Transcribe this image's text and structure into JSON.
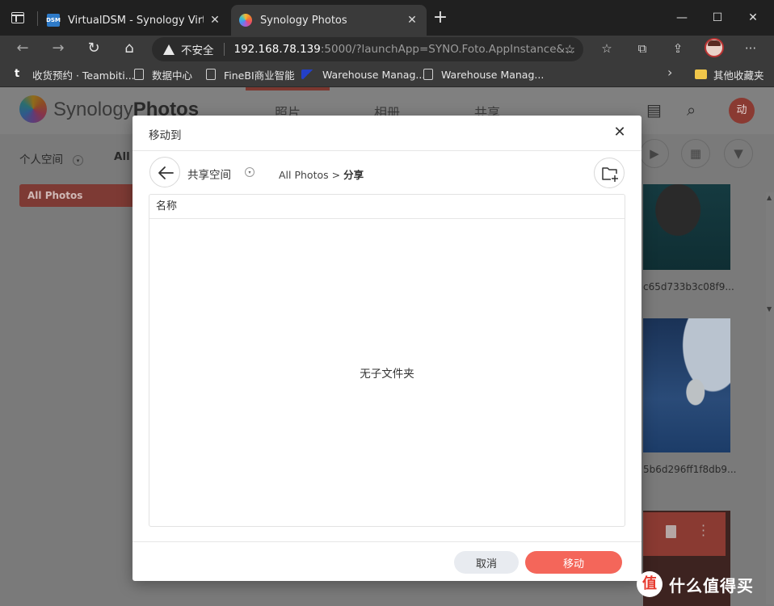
{
  "browser": {
    "tabs": [
      {
        "title": "VirtualDSM - Synology VirtualDS",
        "favicon": "DSM",
        "active": false
      },
      {
        "title": "Synology Photos",
        "active": true
      }
    ],
    "address": {
      "security": "不安全",
      "host": "192.168.78.139",
      "path": ":5000/?launchApp=SYNO.Foto.AppInstance&..."
    },
    "bookmarks": [
      {
        "label": "收货预约 · Teambiti...",
        "icon": "teambition-icon"
      },
      {
        "label": "数据中心",
        "icon": "page-icon"
      },
      {
        "label": "FineBI商业智能",
        "icon": "page-icon"
      },
      {
        "label": "Warehouse Manag...",
        "icon": "warehouse-icon"
      },
      {
        "label": "Warehouse Manag...",
        "icon": "page-icon"
      }
    ],
    "other_bookmarks": "其他收藏夹"
  },
  "app": {
    "brand_light": "Synology",
    "brand_bold": "Photos",
    "tabs": [
      "照片",
      "相册",
      "共享"
    ],
    "selected_tab": 0,
    "user_initial": "动",
    "space_personal": "个人空间",
    "space_all_partial": "All I",
    "sidebar_item": "All Photos",
    "thumbnails": [
      {
        "caption": "c65d733b3c08f9..."
      },
      {
        "caption": "5b6d296ff1f8db9..."
      }
    ]
  },
  "modal": {
    "title": "移动到",
    "space": "共享空间",
    "breadcrumb_root": "All Photos",
    "breadcrumb_sep": ">",
    "breadcrumb_current": "分享",
    "column_name": "名称",
    "empty_text": "无子文件夹",
    "cancel_label": "取消",
    "move_label": "移动"
  },
  "watermark": {
    "text": "什么值得买",
    "logo": "值"
  },
  "colors": {
    "accent": "#f4665a",
    "cancel_bg": "#e8ebf0"
  }
}
